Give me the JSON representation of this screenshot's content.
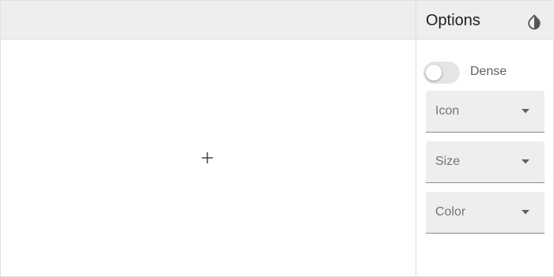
{
  "options": {
    "title": "Options",
    "theme_toggle_icon": "invert-colors-icon",
    "dense": {
      "label": "Dense",
      "checked": false
    },
    "selects": {
      "icon": {
        "label": "Icon"
      },
      "size": {
        "label": "Size"
      },
      "color": {
        "label": "Color"
      }
    }
  },
  "preview": {
    "icon": "add-icon"
  },
  "colors": {
    "toolbar_bg": "#eeeeee",
    "border": "#dcdcdc",
    "text_primary": "#212121",
    "text_secondary": "#757575"
  }
}
